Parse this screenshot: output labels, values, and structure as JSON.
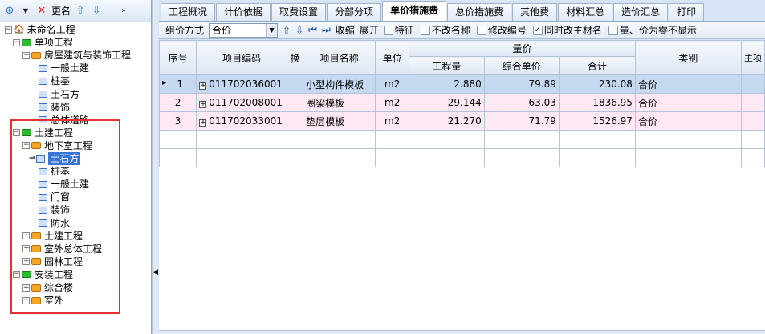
{
  "left_toolbar": {
    "rename_label": "更名"
  },
  "tree": [
    {
      "label": "未命名工程",
      "level": 0,
      "kind": "root",
      "pm": "−"
    },
    {
      "label": "单项工程",
      "level": 1,
      "kind": "green",
      "pm": "−"
    },
    {
      "label": "房屋建筑与装饰工程",
      "level": 2,
      "kind": "orange",
      "pm": "−"
    },
    {
      "label": "一般土建",
      "level": 3,
      "kind": "doc",
      "pm": ""
    },
    {
      "label": "桩基",
      "level": 3,
      "kind": "doc",
      "pm": ""
    },
    {
      "label": "土石方",
      "level": 3,
      "kind": "doc",
      "pm": ""
    },
    {
      "label": "装饰",
      "level": 3,
      "kind": "doc",
      "pm": ""
    },
    {
      "label": "总体道路",
      "level": 3,
      "kind": "doc",
      "pm": ""
    },
    {
      "label": "土建工程",
      "level": 1,
      "kind": "green",
      "pm": "−"
    },
    {
      "label": "地下室工程",
      "level": 2,
      "kind": "orange",
      "pm": "−"
    },
    {
      "label": "土石方",
      "level": 3,
      "kind": "doc",
      "pm": "",
      "selected": true
    },
    {
      "label": "桩基",
      "level": 3,
      "kind": "doc",
      "pm": ""
    },
    {
      "label": "一般土建",
      "level": 3,
      "kind": "doc",
      "pm": ""
    },
    {
      "label": "门窗",
      "level": 3,
      "kind": "doc",
      "pm": ""
    },
    {
      "label": "装饰",
      "level": 3,
      "kind": "doc",
      "pm": ""
    },
    {
      "label": "防水",
      "level": 3,
      "kind": "doc",
      "pm": ""
    },
    {
      "label": "土建工程",
      "level": 2,
      "kind": "orange",
      "pm": "+"
    },
    {
      "label": "室外总体工程",
      "level": 2,
      "kind": "orange",
      "pm": "+"
    },
    {
      "label": "园林工程",
      "level": 2,
      "kind": "orange",
      "pm": "+"
    },
    {
      "label": "安装工程",
      "level": 1,
      "kind": "green",
      "pm": "−"
    },
    {
      "label": "综合楼",
      "level": 2,
      "kind": "orange",
      "pm": "+"
    },
    {
      "label": "室外",
      "level": 2,
      "kind": "orange",
      "pm": "+"
    }
  ],
  "tabs": [
    "工程概况",
    "计价依据",
    "取费设置",
    "分部分项",
    "单价措施费",
    "总价措施费",
    "其他费",
    "材料汇总",
    "造价汇总",
    "打印"
  ],
  "active_tab": 4,
  "toolbar": {
    "method_label": "组价方式",
    "method_value": "合价",
    "collapse_label": "收缩",
    "expand_label": "展开",
    "checks": [
      {
        "label": "特征",
        "checked": false
      },
      {
        "label": "不改名称",
        "checked": false
      },
      {
        "label": "修改编号",
        "checked": false
      },
      {
        "label": "同时改主材名",
        "checked": true
      },
      {
        "label": "量、价为零不显示",
        "checked": false
      }
    ]
  },
  "table": {
    "headers": {
      "seq": "序号",
      "code": "项目编码",
      "swap": "换",
      "name": "项目名称",
      "unit": "单位",
      "group": "量价",
      "qty": "工程量",
      "price": "综合单价",
      "total": "合计",
      "category": "类别",
      "main": "主项"
    },
    "rows": [
      {
        "seq": "1",
        "code": "011702036001",
        "name": "小型构件模板",
        "unit": "m2",
        "qty": "2.880",
        "price": "79.89",
        "total": "230.08",
        "category": "合价"
      },
      {
        "seq": "2",
        "code": "011702008001",
        "name": "圈梁模板",
        "unit": "m2",
        "qty": "29.144",
        "price": "63.03",
        "total": "1836.95",
        "category": "合价"
      },
      {
        "seq": "3",
        "code": "011702033001",
        "name": "垫层模板",
        "unit": "m2",
        "qty": "21.270",
        "price": "71.79",
        "total": "1526.97",
        "category": "合价"
      }
    ]
  }
}
